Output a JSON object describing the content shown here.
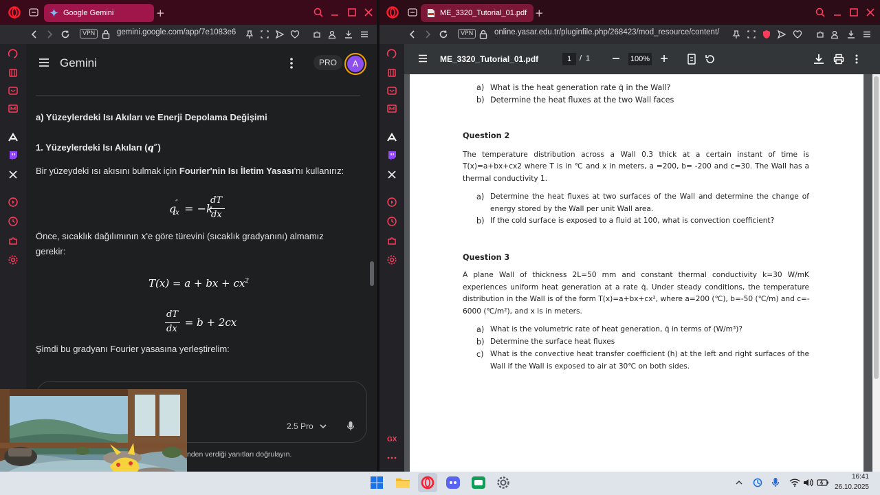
{
  "left_window": {
    "tab_title": "Google Gemini",
    "url": "gemini.google.com/app/7e1083e6",
    "vpn": "VPN",
    "app_name": "Gemini",
    "pro_badge": "PRO",
    "avatar_letter": "A",
    "heading": "a) Yüzeylerdeki Isı Akıları ve Enerji Depolama Değişimi",
    "subheading": "1. Yüzeylerdeki Isı Akıları (",
    "subheading_math": "q″",
    "subheading_end": ")",
    "para1_start": "Bir yüzeydeki ısı akısını bulmak için ",
    "para1_bold": "Fourier'nin Isı İletim Yasası",
    "para1_end": "'nı kullanırız:",
    "eq1_lhs": "q",
    "eq1_sup": "″",
    "eq1_sub": "x",
    "eq1_mid": " = −k",
    "eq1_num": "dT",
    "eq1_den": "dx",
    "para2_start": "Önce, sıcaklık dağılımının ",
    "para2_math": "x",
    "para2_end": "'e göre türevini (sıcaklık gradyanını) almamız",
    "para2_line2": "gerekir:",
    "eq2": "T(x) = a + bx + cx",
    "eq2_sup": "2",
    "eq3_num": "dT",
    "eq3_den": "dx",
    "eq3_rhs": " = b + 2cx",
    "para3": "Şimdi bu gradyanı Fourier yasasına yerleştirelim:",
    "model_selector": "2.5 Pro",
    "footer_text": "nden verdiği yanıtları doğrulayın."
  },
  "right_window": {
    "tab_title": "ME_3320_Tutorial_01.pdf",
    "url": "online.yasar.edu.tr/pluginfile.php/268423/mod_resource/content/",
    "vpn": "VPN",
    "pdf_title": "ME_3320_Tutorial_01.pdf",
    "page_current": "1",
    "page_sep": "/",
    "page_total": "1",
    "zoom": "100%",
    "lines": {
      "q1a_label": "a)",
      "q1a_text": "What is the heat generation rate q̇ in the Wall?",
      "q1b_label": "b)",
      "q1b_text": "Determine the heat fluxes at the two Wall faces",
      "q2_title": "Question 2",
      "q2_p1": "The temperature distribution across a Wall 0.3 thick at a certain instant of time is",
      "q2_p2": "T(x)=a+bx+cx2 where T is in ℃ and x in meters, a =200, b= -200 and c=30. The Wall has a",
      "q2_p3": "thermal conductivity 1.",
      "q2a_label": "a)",
      "q2a_l1": "Determine the heat fluxes at two surfaces of the Wall and determine the change of",
      "q2a_l2": "energy stored by the Wall per unit Wall area.",
      "q2b_label": "b)",
      "q2b_text": "If the cold surface is exposed to a fluid at 100, what is convection coefficient?",
      "q3_title": "Question 3",
      "q3_p1": "A plane Wall of thickness 2L=50 mm and constant thermal conductivity k=30 W/mK",
      "q3_p2": "experiences uniform heat generation at a rate q̇. Under steady conditions, the temperature",
      "q3_p3": "distribution in the Wall is of the form T(x)=a+bx+cx², where a=200 (℃), b=-50 (℃/m) and c=-",
      "q3_p4": "6000 (℃/m²), and x is in meters.",
      "q3a_label": "a)",
      "q3a_text": "What is the volumetric rate of heat generation, q̇ in terms of (W/m³)?",
      "q3b_label": "b)",
      "q3b_text": "Determine the surface heat fluxes",
      "q3c_label": "c)",
      "q3c_l1": "What is the convective heat transfer coefficient (h) at the left and right surfaces of the",
      "q3c_l2": "Wall if the Wall is exposed to air at 30℃ on both sides."
    }
  },
  "taskbar": {
    "time": "16:41",
    "date": "26.10.2025"
  },
  "colors": {
    "opera_red": "#ff1b2d",
    "gemini_purple": "#8e4ff0",
    "accent_tab": "#a0164a"
  }
}
